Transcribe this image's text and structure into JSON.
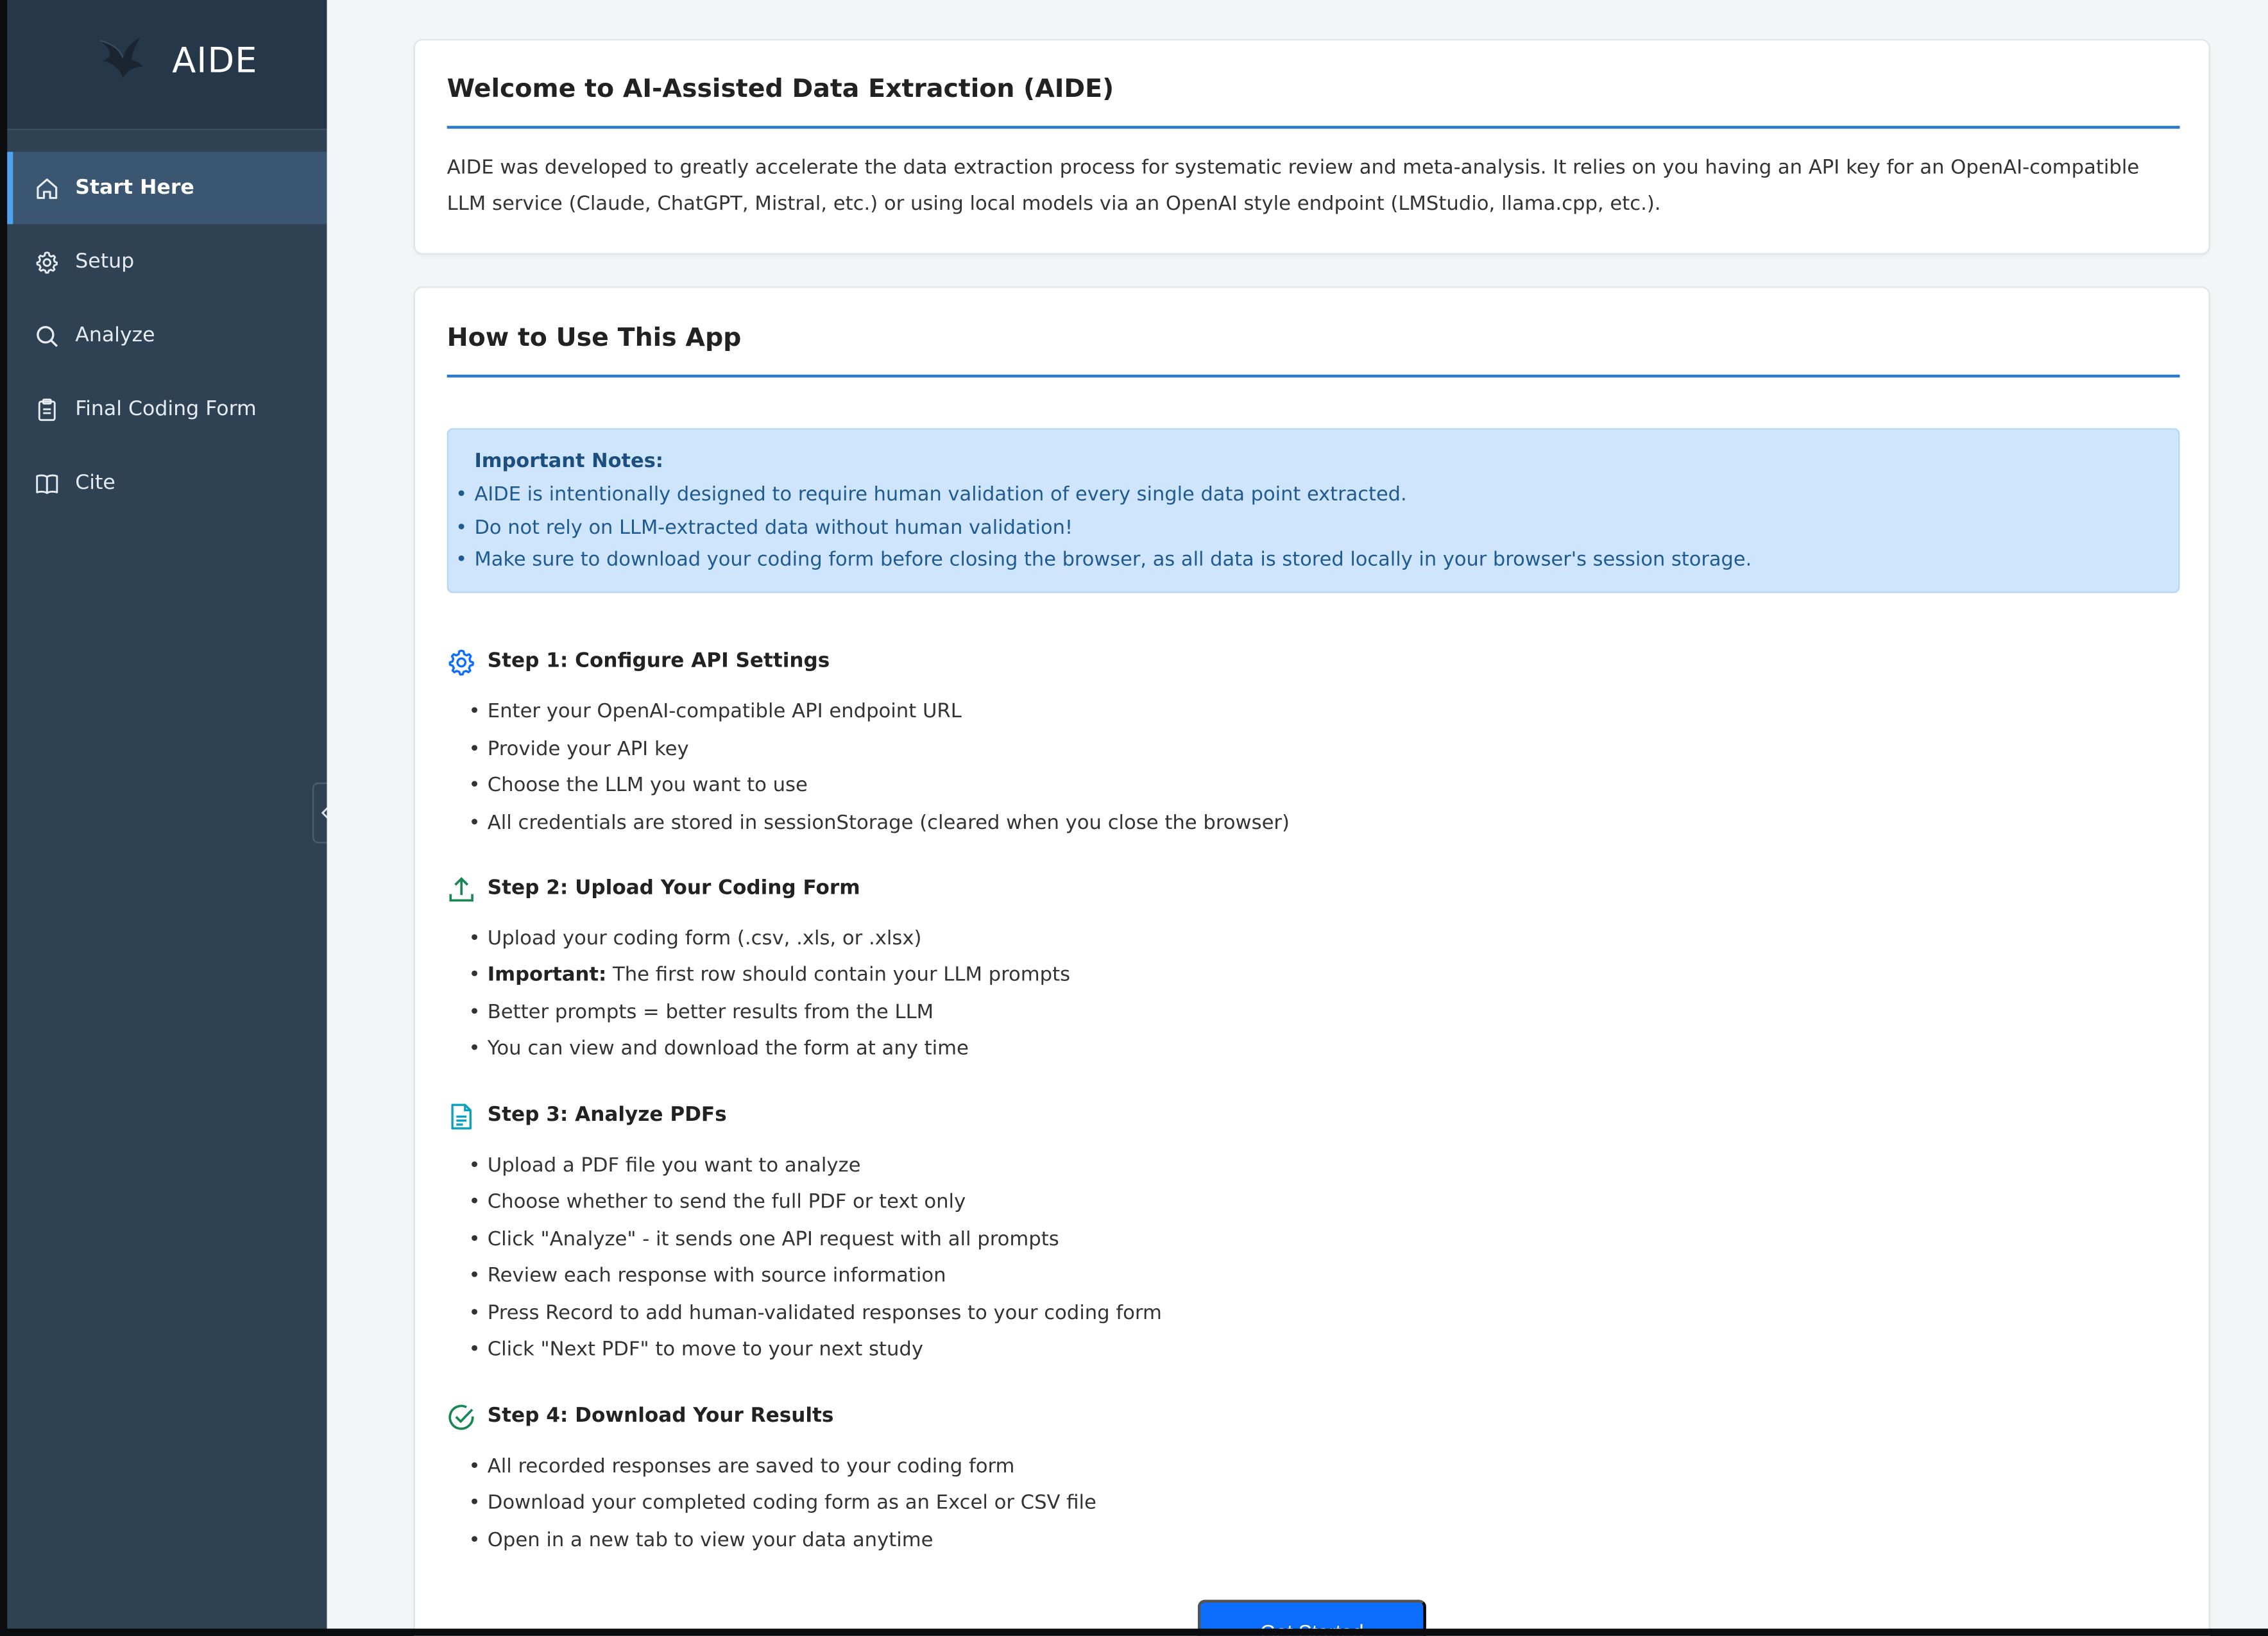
{
  "app": {
    "name": "AIDE",
    "accent_color": "#2f79c9",
    "sidebar_color": "#2f4254",
    "button_color": "#0d6efd"
  },
  "sidebar": {
    "items": [
      {
        "label": "Start Here",
        "icon": "home-icon",
        "active": true
      },
      {
        "label": "Setup",
        "icon": "gear-icon",
        "active": false
      },
      {
        "label": "Analyze",
        "icon": "search-icon",
        "active": false
      },
      {
        "label": "Final Coding Form",
        "icon": "clipboard-icon",
        "active": false
      },
      {
        "label": "Cite",
        "icon": "book-icon",
        "active": false
      }
    ],
    "collapse_icon": "chevron-left-icon"
  },
  "welcome": {
    "title": "Welcome to AI-Assisted Data Extraction (AIDE)",
    "body": "AIDE was developed to greatly accelerate the data extraction process for systematic review and meta-analysis. It relies on you having an API key for an OpenAI-compatible LLM service (Claude, ChatGPT, Mistral, etc.) or using local models via an OpenAI style endpoint (LMStudio, llama.cpp, etc.)."
  },
  "howto": {
    "title": "How to Use This App",
    "notes": {
      "title": "Important Notes:",
      "items": [
        "AIDE is intentionally designed to require human validation of every single data point extracted.",
        "Do not rely on LLM-extracted data without human validation!",
        "Make sure to download your coding form before closing the browser, as all data is stored locally in your browser's session storage."
      ]
    },
    "steps": [
      {
        "title": "Step 1: Configure API Settings",
        "icon": "gear-icon",
        "icon_color": "#0d6efd",
        "items": [
          "Enter your OpenAI-compatible API endpoint URL",
          "Provide your API key",
          "Choose the LLM you want to use",
          "All credentials are stored in sessionStorage (cleared when you close the browser)"
        ]
      },
      {
        "title": "Step 2: Upload Your Coding Form",
        "icon": "upload-icon",
        "icon_color": "#198754",
        "items": [
          "Upload your coding form (.csv, .xls, or .xlsx)",
          {
            "strong": "Important:",
            "text": " The first row should contain your LLM prompts"
          },
          "Better prompts = better results from the LLM",
          "You can view and download the form at any time"
        ]
      },
      {
        "title": "Step 3: Analyze PDFs",
        "icon": "file-text-icon",
        "icon_color": "#0aa2c0",
        "items": [
          "Upload a PDF file you want to analyze",
          "Choose whether to send the full PDF or text only",
          "Click \"Analyze\" - it sends one API request with all prompts",
          "Review each response with source information",
          "Press Record to add human-validated responses to your coding form",
          "Click \"Next PDF\" to move to your next study"
        ]
      },
      {
        "title": "Step 4: Download Your Results",
        "icon": "check-circle-icon",
        "icon_color": "#198754",
        "items": [
          "All recorded responses are saved to your coding form",
          "Download your completed coding form as an Excel or CSV file",
          "Open in a new tab to view your data anytime"
        ]
      }
    ],
    "cta_label": "Get Started"
  }
}
